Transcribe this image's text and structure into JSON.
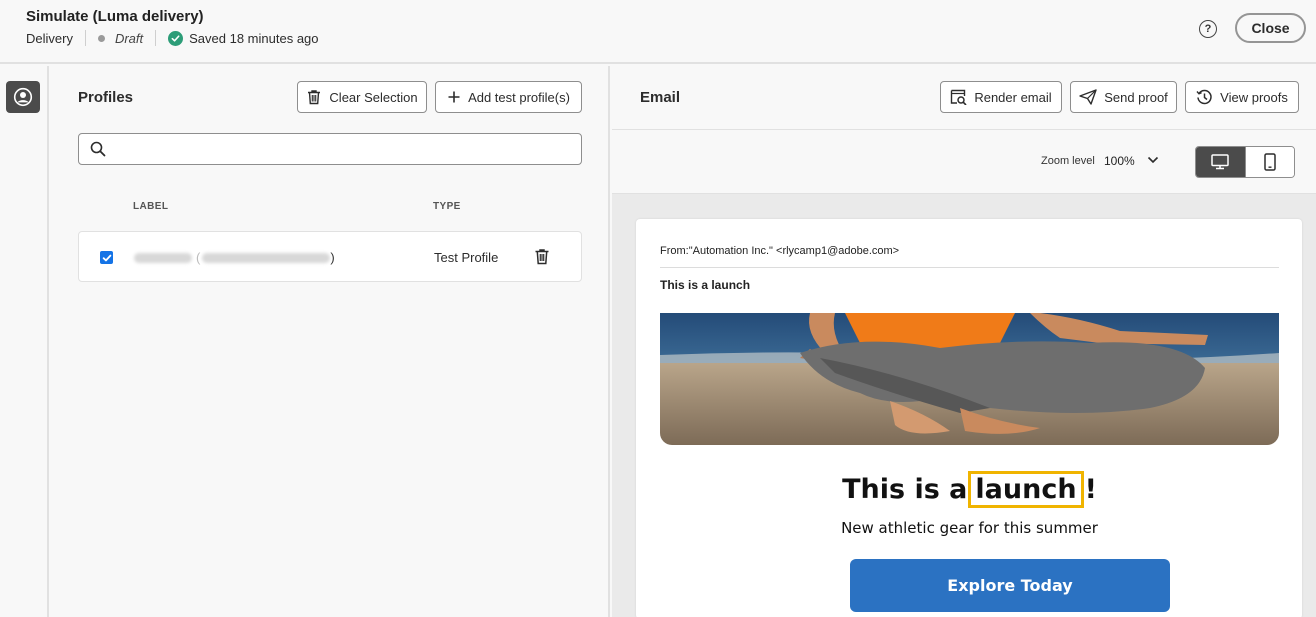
{
  "header": {
    "title": "Simulate (Luma delivery)",
    "type": "Delivery",
    "status": "Draft",
    "saved": "Saved 18 minutes ago",
    "help": "?",
    "close_label": "Close"
  },
  "profiles": {
    "title": "Profiles",
    "clear_label": "Clear Selection",
    "add_label": "Add test profile(s)",
    "search_value": "",
    "columns": {
      "label": "LABEL",
      "type": "TYPE"
    },
    "rows": [
      {
        "checked": true,
        "label_suffix": ")",
        "type": "Test Profile"
      }
    ]
  },
  "email": {
    "title": "Email",
    "render_label": "Render email",
    "send_label": "Send proof",
    "view_label": "View proofs",
    "zoom_label": "Zoom level",
    "zoom_value": "100%",
    "view_mode": "desktop",
    "preview": {
      "from": "From:\"Automation Inc.\" <rlycamp1@adobe.com>",
      "subject": "This is a launch",
      "headline_pre": "This is a",
      "headline_highlight": "launch",
      "headline_post": "!",
      "subheadline": "New athletic gear for this summer",
      "cta": "Explore Today"
    }
  },
  "colors": {
    "accent": "#1473e6",
    "success": "#2d9d78",
    "cta": "#2b72c2",
    "highlight": "#f0b400"
  }
}
